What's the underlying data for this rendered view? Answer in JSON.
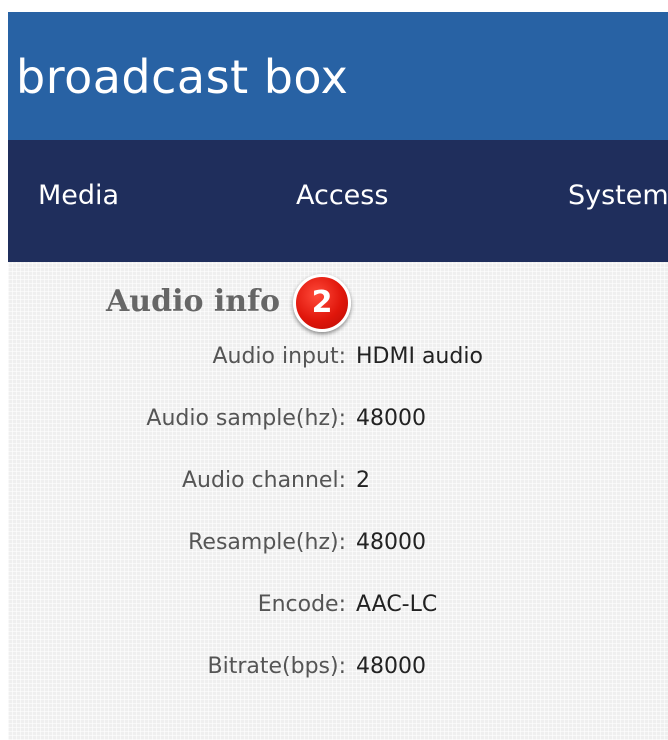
{
  "header": {
    "brand": "broadcast box"
  },
  "nav": {
    "items": [
      {
        "label": "Media"
      },
      {
        "label": "Access"
      },
      {
        "label": "System"
      }
    ]
  },
  "main": {
    "section_title": "Audio info",
    "badge": "2",
    "rows": [
      {
        "label": "Audio input:",
        "value": "HDMI audio"
      },
      {
        "label": "Audio sample(hz):",
        "value": "48000"
      },
      {
        "label": "Audio channel:",
        "value": "2"
      },
      {
        "label": "Resample(hz):",
        "value": "48000"
      },
      {
        "label": "Encode:",
        "value": "AAC-LC"
      },
      {
        "label": "Bitrate(bps):",
        "value": "48000"
      }
    ]
  },
  "colors": {
    "header_bg": "#2862a4",
    "nav_bg": "#1f2e5c",
    "content_bg": "#efefef",
    "badge": "#e0160b"
  }
}
